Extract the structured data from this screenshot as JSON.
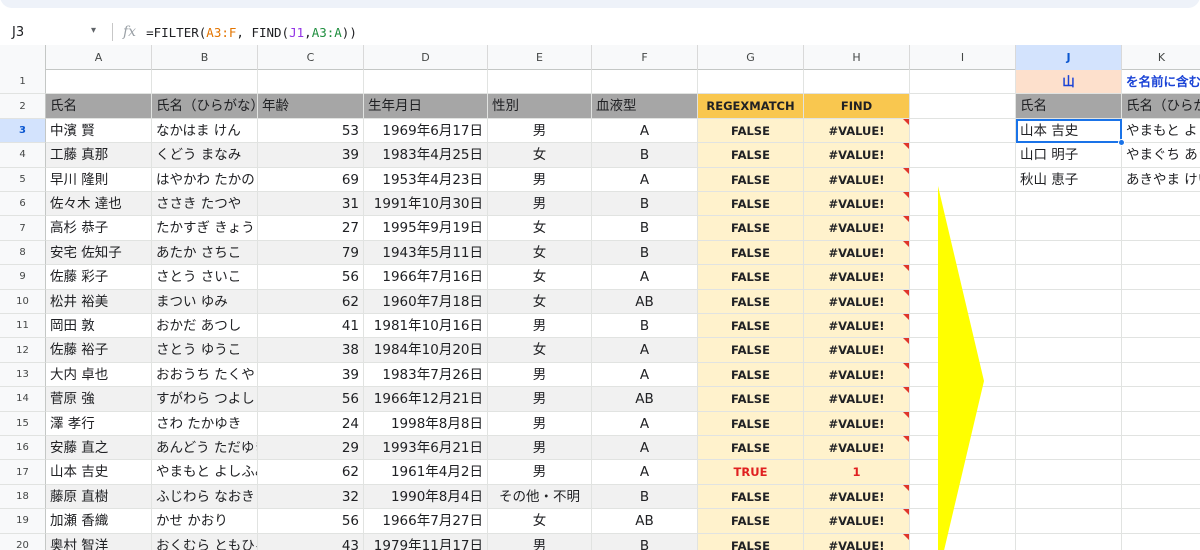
{
  "formula_bar": {
    "cell_ref": "J3",
    "fx_icon": "fx-icon",
    "formula_prefix": "=FILTER(",
    "formula_range1": "A3:F",
    "formula_mid1": ", FIND(",
    "formula_range2": "J1",
    "formula_mid2": ",",
    "formula_range3": "A3:A",
    "formula_suffix": "))"
  },
  "columns": [
    "A",
    "B",
    "C",
    "D",
    "E",
    "F",
    "G",
    "H",
    "I",
    "J",
    "K"
  ],
  "selected_column": "J",
  "row_numbers": [
    "1",
    "2",
    "3",
    "4",
    "5",
    "6",
    "7",
    "8",
    "9",
    "10",
    "11",
    "12",
    "13",
    "14",
    "15",
    "16",
    "17",
    "18",
    "19",
    "20"
  ],
  "selected_row": "3",
  "header_row": {
    "name": "氏名",
    "kana": "氏名（ひらがな）",
    "age": "年齢",
    "birth": "生年月日",
    "gender": "性別",
    "blood": "血液型",
    "regexmatch": "REGEXMATCH",
    "find": "FIND"
  },
  "rows": [
    {
      "name": "中濱 賢",
      "kana": "なかはま けん",
      "age": "53",
      "birth": "1969年6月17日",
      "gender": "男",
      "blood": "A",
      "g": "FALSE",
      "h": "#VALUE!"
    },
    {
      "name": "工藤 真那",
      "kana": "くどう まなみ",
      "age": "39",
      "birth": "1983年4月25日",
      "gender": "女",
      "blood": "B",
      "g": "FALSE",
      "h": "#VALUE!"
    },
    {
      "name": "早川 隆則",
      "kana": "はやかわ たかのり",
      "age": "69",
      "birth": "1953年4月23日",
      "gender": "男",
      "blood": "A",
      "g": "FALSE",
      "h": "#VALUE!"
    },
    {
      "name": "佐々木 達也",
      "kana": "ささき たつや",
      "age": "31",
      "birth": "1991年10月30日",
      "gender": "男",
      "blood": "B",
      "g": "FALSE",
      "h": "#VALUE!"
    },
    {
      "name": "高杉 恭子",
      "kana": "たかすぎ きょうこ",
      "age": "27",
      "birth": "1995年9月19日",
      "gender": "女",
      "blood": "B",
      "g": "FALSE",
      "h": "#VALUE!"
    },
    {
      "name": "安宅 佐知子",
      "kana": "あたか さちこ",
      "age": "79",
      "birth": "1943年5月11日",
      "gender": "女",
      "blood": "B",
      "g": "FALSE",
      "h": "#VALUE!"
    },
    {
      "name": "佐藤 彩子",
      "kana": "さとう さいこ",
      "age": "56",
      "birth": "1966年7月16日",
      "gender": "女",
      "blood": "A",
      "g": "FALSE",
      "h": "#VALUE!"
    },
    {
      "name": "松井 裕美",
      "kana": "まつい ゆみ",
      "age": "62",
      "birth": "1960年7月18日",
      "gender": "女",
      "blood": "AB",
      "g": "FALSE",
      "h": "#VALUE!"
    },
    {
      "name": "岡田 敦",
      "kana": "おかだ あつし",
      "age": "41",
      "birth": "1981年10月16日",
      "gender": "男",
      "blood": "B",
      "g": "FALSE",
      "h": "#VALUE!"
    },
    {
      "name": "佐藤 裕子",
      "kana": "さとう ゆうこ",
      "age": "38",
      "birth": "1984年10月20日",
      "gender": "女",
      "blood": "A",
      "g": "FALSE",
      "h": "#VALUE!"
    },
    {
      "name": "大内 卓也",
      "kana": "おおうち たくや",
      "age": "39",
      "birth": "1983年7月26日",
      "gender": "男",
      "blood": "A",
      "g": "FALSE",
      "h": "#VALUE!"
    },
    {
      "name": "菅原 強",
      "kana": "すがわら つよし",
      "age": "56",
      "birth": "1966年12月21日",
      "gender": "男",
      "blood": "AB",
      "g": "FALSE",
      "h": "#VALUE!"
    },
    {
      "name": "澤 孝行",
      "kana": "さわ たかゆき",
      "age": "24",
      "birth": "1998年8月8日",
      "gender": "男",
      "blood": "A",
      "g": "FALSE",
      "h": "#VALUE!"
    },
    {
      "name": "安藤 直之",
      "kana": "あんどう ただゆき",
      "age": "29",
      "birth": "1993年6月21日",
      "gender": "男",
      "blood": "A",
      "g": "FALSE",
      "h": "#VALUE!"
    },
    {
      "name": "山本 吉史",
      "kana": "やまもと よしふみ",
      "age": "62",
      "birth": "1961年4月2日",
      "gender": "男",
      "blood": "A",
      "g": "TRUE",
      "h": "1"
    },
    {
      "name": "藤原 直樹",
      "kana": "ふじわら なおき",
      "age": "32",
      "birth": "1990年8月4日",
      "gender": "その他・不明",
      "blood": "B",
      "g": "FALSE",
      "h": "#VALUE!"
    },
    {
      "name": "加瀬 香織",
      "kana": "かせ かおり",
      "age": "56",
      "birth": "1966年7月27日",
      "gender": "女",
      "blood": "AB",
      "g": "FALSE",
      "h": "#VALUE!"
    },
    {
      "name": "奥村 智洋",
      "kana": "おくむら ともひろ",
      "age": "43",
      "birth": "1979年11月17日",
      "gender": "男",
      "blood": "B",
      "g": "FALSE",
      "h": "#VALUE!"
    }
  ],
  "j1": "山",
  "k1": "を名前に含む",
  "j2": "氏名",
  "k2": "氏名（ひらがな）",
  "results": [
    {
      "name": "山本 吉史",
      "kana": "やまもと よしふみ"
    },
    {
      "name": "山口 明子",
      "kana": "やまぐち あきこ"
    },
    {
      "name": "秋山 恵子",
      "kana": "あきやま けいこ"
    }
  ],
  "colors": {
    "header_gray": "#a6a6a6",
    "g_header": "#f9c74f",
    "g_cell": "#fff2cc",
    "arrow": "#ffff00",
    "selection": "#1a73e8"
  }
}
